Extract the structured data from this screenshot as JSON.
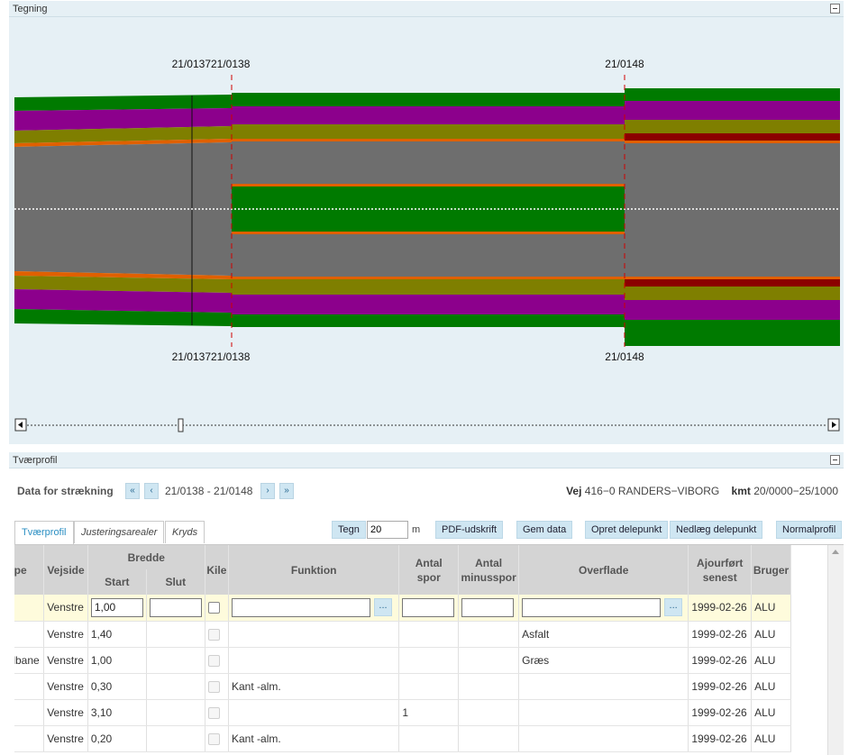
{
  "drawing": {
    "title": "Tegning",
    "markers": [
      {
        "top_label": "21/013721/0138",
        "bottom_label": "21/013721/0138"
      },
      {
        "top_label": "21/0148",
        "bottom_label": "21/0148"
      }
    ],
    "colors": {
      "green": "#007a00",
      "purple": "#8c008c",
      "olive": "#7f7f00",
      "orange": "#e06000",
      "darkred": "#8b0000",
      "gray": "#6e6e6e",
      "marker": "#d00000"
    }
  },
  "profile": {
    "title": "Tværprofil",
    "strek_title": "Data for strækning",
    "nav": {
      "first": "«",
      "prev": "‹",
      "next": "›",
      "last": "»"
    },
    "range": "21/0138 - 21/0148",
    "vej_label": "Vej",
    "vej_value": "416−0 RANDERS−VIBORG",
    "kmt_label": "kmt",
    "kmt_value": "20/0000−25/1000",
    "tabs": [
      "Tværprofil",
      "Justeringsarealer",
      "Kryds"
    ],
    "active_tab": "Tværprofil",
    "toolbar": {
      "tegn": "Tegn",
      "tegn_value": "20",
      "unit": "m",
      "pdf": "PDF-udskrift",
      "gem": "Gem data",
      "opret": "Opret delepunkt",
      "nedlaeg": "Nedlæg delepunkt",
      "normal": "Normalprofil"
    },
    "columns": {
      "type": "Type",
      "vejside": "Vejside",
      "bredde": "Bredde",
      "start": "Start",
      "slut": "Slut",
      "kile": "Kile",
      "funktion": "Funktion",
      "antal_spor": "Antal spor",
      "antal_minusspor": "Antal minusspor",
      "overflade": "Overflade",
      "ajourfort": "Ajourført senest",
      "bruger": "Bruger"
    },
    "edit_row": {
      "type": "",
      "vejside": "Venstre",
      "start": "1,00",
      "slut": "",
      "funktion": "",
      "antal_spor": "",
      "antal_minusspor": "",
      "overflade": "",
      "ajourfort": "1999-02-26",
      "bruger": "ALU",
      "dots": "..."
    },
    "rows": [
      {
        "type": "",
        "vejside": "Venstre",
        "start": "1,40",
        "slut": "",
        "funktion": "",
        "antal_spor": "",
        "antal_minusspor": "",
        "overflade": "Asfalt",
        "ajourfort": "1999-02-26",
        "bruger": "ALU"
      },
      {
        "type": "Cykelbane",
        "vejside": "Venstre",
        "start": "1,00",
        "slut": "",
        "funktion": "",
        "antal_spor": "",
        "antal_minusspor": "",
        "overflade": "Græs",
        "ajourfort": "1999-02-26",
        "bruger": "ALU"
      },
      {
        "type": "",
        "vejside": "Venstre",
        "start": "0,30",
        "slut": "",
        "funktion": "Kant -alm.",
        "antal_spor": "",
        "antal_minusspor": "",
        "overflade": "",
        "ajourfort": "1999-02-26",
        "bruger": "ALU"
      },
      {
        "type": "",
        "vejside": "Venstre",
        "start": "3,10",
        "slut": "",
        "funktion": "",
        "antal_spor": "1",
        "antal_minusspor": "",
        "overflade": "",
        "ajourfort": "1999-02-26",
        "bruger": "ALU"
      },
      {
        "type": "",
        "vejside": "Venstre",
        "start": "0,20",
        "slut": "",
        "funktion": "Kant -alm.",
        "antal_spor": "",
        "antal_minusspor": "",
        "overflade": "",
        "ajourfort": "1999-02-26",
        "bruger": "ALU"
      }
    ]
  }
}
